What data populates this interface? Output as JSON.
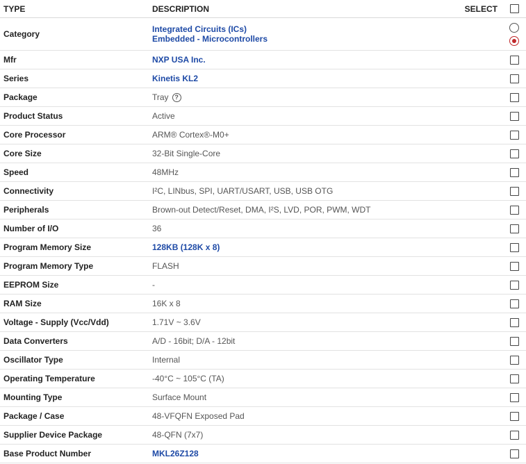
{
  "header": {
    "type": "TYPE",
    "description": "DESCRIPTION",
    "select": "SELECT"
  },
  "category": {
    "type": "Category",
    "links": [
      "Integrated Circuits (ICs)",
      "Embedded - Microcontrollers"
    ],
    "selected_index": 1
  },
  "rows": [
    {
      "type": "Mfr",
      "value": "NXP USA Inc.",
      "link": true
    },
    {
      "type": "Series",
      "value": "Kinetis KL2",
      "link": true
    },
    {
      "type": "Package",
      "value": "Tray",
      "link": false,
      "help": true
    },
    {
      "type": "Product Status",
      "value": "Active",
      "link": false
    },
    {
      "type": "Core Processor",
      "value": "ARM® Cortex®-M0+",
      "link": false
    },
    {
      "type": "Core Size",
      "value": "32-Bit Single-Core",
      "link": false
    },
    {
      "type": "Speed",
      "value": "48MHz",
      "link": false
    },
    {
      "type": "Connectivity",
      "value": "I²C, LINbus, SPI, UART/USART, USB, USB OTG",
      "link": false
    },
    {
      "type": "Peripherals",
      "value": "Brown-out Detect/Reset, DMA, I²S, LVD, POR, PWM, WDT",
      "link": false
    },
    {
      "type": "Number of I/O",
      "value": "36",
      "link": false
    },
    {
      "type": "Program Memory Size",
      "value": "128KB (128K x 8)",
      "link": true
    },
    {
      "type": "Program Memory Type",
      "value": "FLASH",
      "link": false
    },
    {
      "type": "EEPROM Size",
      "value": "-",
      "link": false
    },
    {
      "type": "RAM Size",
      "value": "16K x 8",
      "link": false
    },
    {
      "type": "Voltage - Supply (Vcc/Vdd)",
      "value": "1.71V ~ 3.6V",
      "link": false
    },
    {
      "type": "Data Converters",
      "value": "A/D - 16bit; D/A - 12bit",
      "link": false
    },
    {
      "type": "Oscillator Type",
      "value": "Internal",
      "link": false
    },
    {
      "type": "Operating Temperature",
      "value": "-40°C ~ 105°C (TA)",
      "link": false
    },
    {
      "type": "Mounting Type",
      "value": "Surface Mount",
      "link": false
    },
    {
      "type": "Package / Case",
      "value": "48-VFQFN Exposed Pad",
      "link": false
    },
    {
      "type": "Supplier Device Package",
      "value": "48-QFN (7x7)",
      "link": false
    },
    {
      "type": "Base Product Number",
      "value": "MKL26Z128",
      "link": true
    }
  ],
  "icons": {
    "help": "question-circle-icon"
  },
  "colors": {
    "link": "#1e4aa6",
    "radio_selected": "#c0282a"
  }
}
